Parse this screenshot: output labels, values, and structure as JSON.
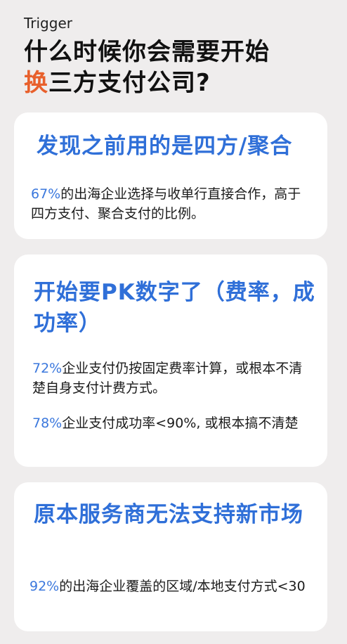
{
  "header": {
    "eyebrow": "Trigger",
    "title_line1": "什么时候你会需要开始",
    "title_accent": "换",
    "title_line2_rest": "三方支付公司?"
  },
  "cards": [
    {
      "title": "发现之前用的是四方/聚合",
      "stats": [
        {
          "number": "67%",
          "text": "的出海企业选择与收单行直接合作，高于四方支付、聚合支付的比例。"
        }
      ]
    },
    {
      "title": "开始要PK数字了（费率，成功率）",
      "stats": [
        {
          "number": "72%",
          "text": "企业支付仍按固定费率计算，或根本不清楚自身支付计费方式。"
        },
        {
          "number": "78%",
          "text": "企业支付成功率<90%, 或根本搞不清楚"
        }
      ]
    },
    {
      "title": "原本服务商无法支持新市场",
      "stats": [
        {
          "number": "92%",
          "text": "的出海企业覆盖的区域/本地支付方式<30"
        }
      ]
    }
  ],
  "colors": {
    "background": "#efeded",
    "card": "#ffffff",
    "card_title_blue": "#2f6fd8",
    "stat_number_blue": "#3b78dd",
    "accent_orange": "#e8602c"
  }
}
